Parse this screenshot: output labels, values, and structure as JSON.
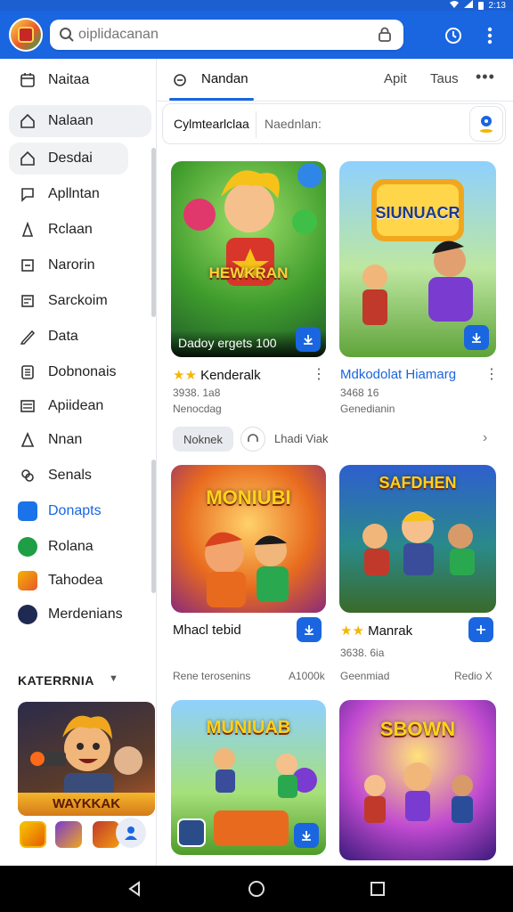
{
  "status_bar": {
    "time": "2:13"
  },
  "header": {
    "search_placeholder": "oiplidacanan",
    "accent": "#1a66e0"
  },
  "sidebar": {
    "items": [
      {
        "label": "Naitaa",
        "icon": "calendar-icon"
      },
      {
        "label": "Nalaan",
        "icon": "home-icon"
      },
      {
        "label": "Desdai",
        "icon": "home-icon"
      },
      {
        "label": "Apllntan",
        "icon": "chat-icon"
      },
      {
        "label": "Rclaan",
        "icon": "person-icon"
      },
      {
        "label": "Narorin",
        "icon": "square-icon"
      },
      {
        "label": "Sarckoim",
        "icon": "list-box-icon"
      },
      {
        "label": "Data",
        "icon": "pen-icon"
      },
      {
        "label": "Dobnonais",
        "icon": "document-icon"
      },
      {
        "label": "Apiidean",
        "icon": "list-icon"
      },
      {
        "label": "Nnan",
        "icon": "person-icon"
      },
      {
        "label": "Senals",
        "icon": "link-icon"
      },
      {
        "label": "Donapts",
        "icon": "blue-app-icon"
      },
      {
        "label": "Rolana",
        "icon": "green-app-icon"
      },
      {
        "label": "Tahodea",
        "icon": "orange-app-icon"
      },
      {
        "label": "Merdenians",
        "icon": "dark-app-icon"
      }
    ],
    "category_title": "KATERRNIA",
    "category_banner": "WAYKKAK"
  },
  "tabs": [
    {
      "label": "Nandan"
    },
    {
      "label": "Apit"
    },
    {
      "label": "Taus"
    }
  ],
  "chips": {
    "active": "Cylmtearlclaa",
    "secondary": "Naednlan:"
  },
  "filters": {
    "pill": "Noknek",
    "text": "Lhadi Viak"
  },
  "cards": [
    {
      "art_title": "HEWKRAN",
      "caption": "Dadoy ergets 100",
      "title": "Kenderalk",
      "meta1": "3938. 1a8",
      "meta2": "Nenocdag",
      "title_blue": false,
      "stars": true
    },
    {
      "art_title": "SIUNUACR",
      "caption": "",
      "title": "Mdkodolat Hiamarg",
      "meta1": "3468 16",
      "meta2": "Genedianin",
      "title_blue": true,
      "stars": false
    },
    {
      "art_title": "MONIUBI",
      "caption": "",
      "title": "Mhacl tebid",
      "meta1": "Rene terosenins",
      "meta2": "A1000k",
      "title_blue": false,
      "stars": false
    },
    {
      "art_title": "SAFDHEN",
      "caption": "",
      "title": "Manrak",
      "meta1": "3638. 6ia",
      "meta2": "Geenmiad",
      "meta3": "Redio X",
      "title_blue": false,
      "stars": true
    },
    {
      "art_title": "MUNIUAB",
      "caption": "",
      "title": "",
      "title_blue": false,
      "stars": false
    },
    {
      "art_title": "SBOWN",
      "caption": "",
      "title": "",
      "title_blue": false,
      "stars": false
    }
  ]
}
